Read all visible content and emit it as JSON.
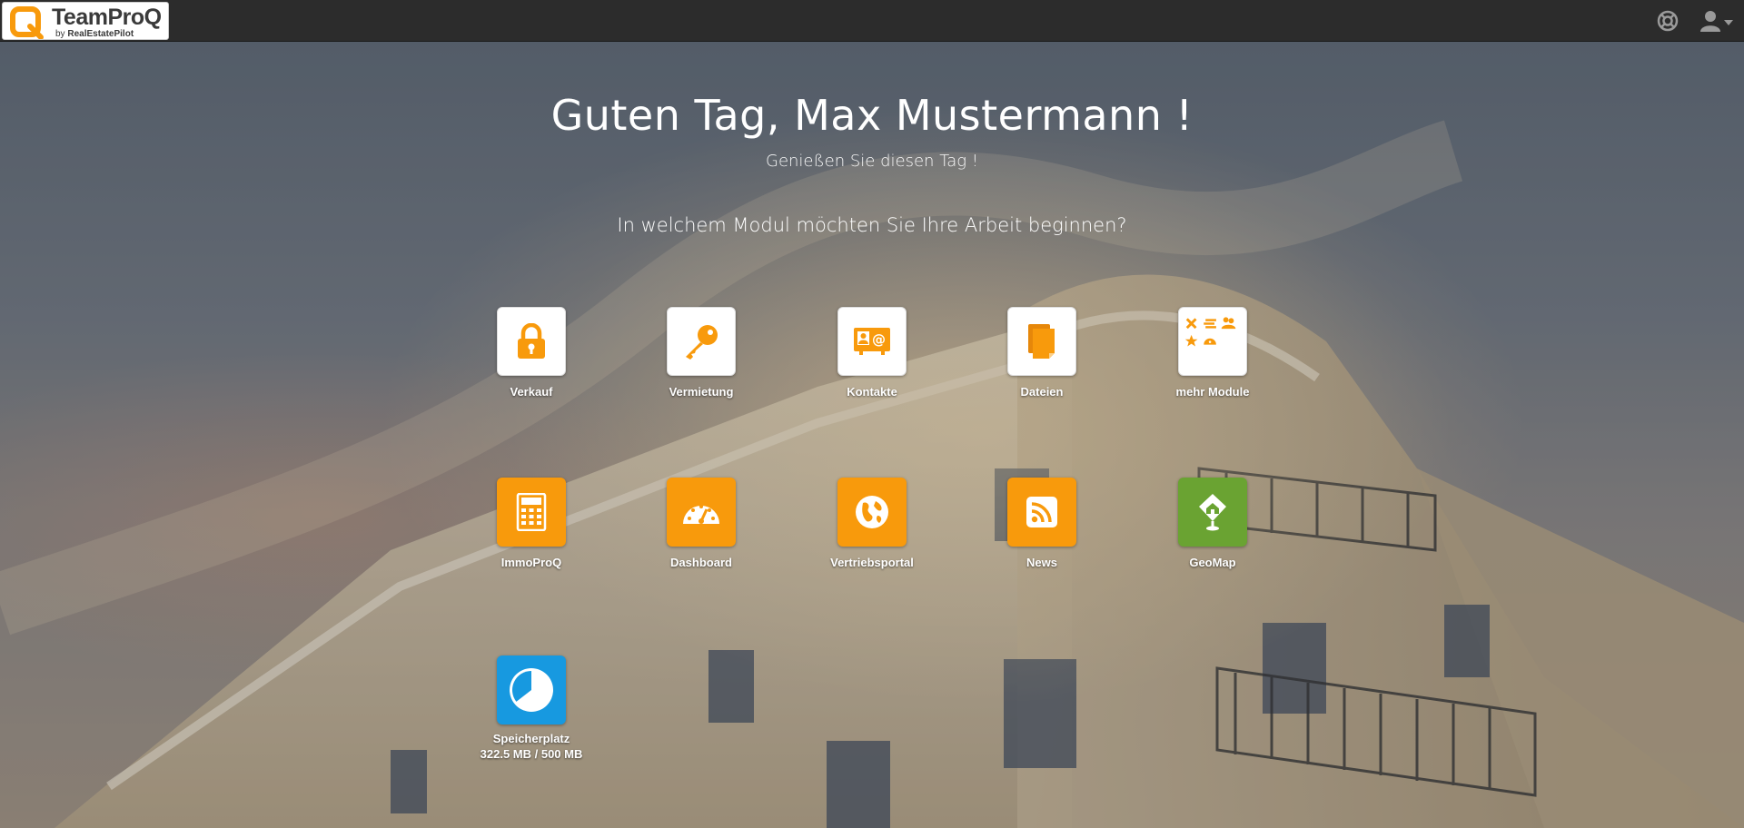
{
  "app": {
    "logo_name": "TeamProQ",
    "logo_by": "by",
    "logo_company": "RealEstatePilot"
  },
  "header": {
    "icons": [
      "support-icon",
      "user-icon",
      "caret-down-icon"
    ]
  },
  "greeting": {
    "title": "Guten Tag, Max Mustermann !",
    "subtitle": "Genießen Sie diesen Tag !",
    "question": "In welchem Modul möchten Sie Ihre Arbeit beginnen?"
  },
  "modules": {
    "verkauf": {
      "label": "Verkauf",
      "icon": "lock-icon"
    },
    "vermietung": {
      "label": "Vermietung",
      "icon": "key-icon"
    },
    "kontakte": {
      "label": "Kontakte",
      "icon": "contact-card-icon"
    },
    "dateien": {
      "label": "Dateien",
      "icon": "files-icon"
    },
    "mehr_module": {
      "label": "mehr Module",
      "icon": "modules-grid-icon"
    },
    "immoproq": {
      "label": "ImmoProQ",
      "icon": "calculator-icon"
    },
    "dashboard": {
      "label": "Dashboard",
      "icon": "gauge-icon"
    },
    "vertriebsportal": {
      "label": "Vertriebsportal",
      "icon": "globe-icon"
    },
    "news": {
      "label": "News",
      "icon": "rss-icon"
    },
    "geomap": {
      "label": "GeoMap",
      "icon": "map-pin-icon"
    },
    "speicherplatz": {
      "label": "Speicherplatz",
      "usage": "322.5 MB / 500 MB",
      "icon": "pie-chart-icon",
      "used_fraction": 0.645
    }
  },
  "colors": {
    "orange": "#f89a0c",
    "green": "#6aa332",
    "blue": "#1799e0",
    "header_bg": "#2c2c2c"
  }
}
